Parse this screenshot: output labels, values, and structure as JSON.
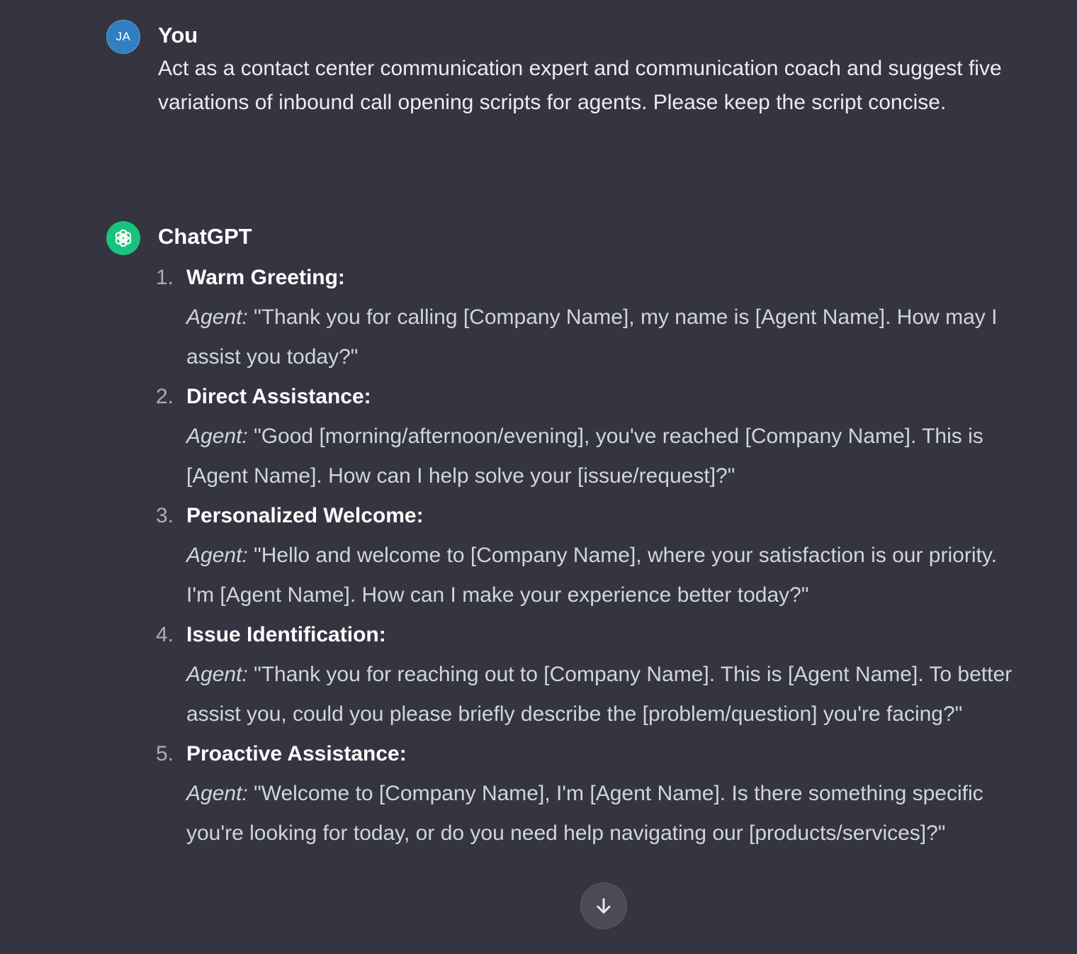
{
  "user_message": {
    "avatar_initials": "JA",
    "author": "You",
    "text": "Act as a contact center communication expert and communication coach and suggest five variations of inbound call opening scripts for agents. Please keep the script concise."
  },
  "assistant_message": {
    "author": "ChatGPT",
    "items": [
      {
        "number": "1.",
        "title": "Warm Greeting:",
        "label": "Agent:",
        "text": " \"Thank you for calling [Company Name], my name is [Agent Name]. How may I assist you today?\""
      },
      {
        "number": "2.",
        "title": "Direct Assistance:",
        "label": "Agent:",
        "text": " \"Good [morning/afternoon/evening], you've reached [Company Name]. This is [Agent Name]. How can I help solve your [issue/request]?\""
      },
      {
        "number": "3.",
        "title": "Personalized Welcome:",
        "label": "Agent:",
        "text": " \"Hello and welcome to [Company Name], where your satisfaction is our priority. I'm [Agent Name]. How can I make your experience better today?\""
      },
      {
        "number": "4.",
        "title": "Issue Identification:",
        "label": "Agent:",
        "text": " \"Thank you for reaching out to [Company Name]. This is [Agent Name]. To better assist you, could you please briefly describe the [problem/question] you're facing?\""
      },
      {
        "number": "5.",
        "title": "Proactive Assistance:",
        "label": "Agent:",
        "text": " \"Welcome to [Company Name], I'm [Agent Name]. Is there something specific you're looking for today, or do you need help navigating our [products/services]?\""
      }
    ]
  },
  "icons": {
    "assistant_avatar": "openai-logo-icon",
    "scroll_button": "arrow-down-icon"
  },
  "colors": {
    "background": "#343541",
    "user_avatar": "#2f7fc2",
    "assistant_avatar": "#19c37d"
  }
}
